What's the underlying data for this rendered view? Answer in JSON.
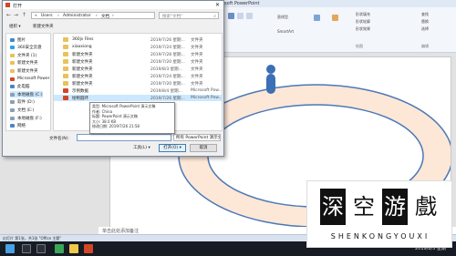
{
  "ppt": {
    "title": "osoft PowerPoint",
    "ribbon": {
      "grp1": [
        "直线型",
        "SmartArt"
      ],
      "grp2": [
        "形状填充",
        "形状轮廓",
        "形状效果"
      ],
      "grp3": [
        "查找",
        "替换",
        "选择"
      ],
      "grp_titles": [
        "绘图",
        "编辑"
      ]
    },
    "notes_placeholder": "单击此处添加备注",
    "status_text": "幻灯片 第1张，共1张    \"Office 主题\"",
    "zoom": "63%"
  },
  "dialog": {
    "title": "打开",
    "close": "✕",
    "breadcrumb": [
      "«",
      "Users",
      "›",
      "Administrator",
      "›",
      "文档",
      "›"
    ],
    "search_placeholder": "搜索\"文档\"",
    "toolbar": {
      "organize": "组织 ▾",
      "new_folder": "新建文件夹"
    },
    "nav_items": [
      {
        "label": "图片",
        "color": "#3f88d0"
      },
      {
        "label": "360安全云盘",
        "color": "#2aa3e8"
      },
      {
        "label": "文件夹 (1)",
        "color": "#e8c25a"
      },
      {
        "label": "新建文件夹",
        "color": "#e8c25a"
      },
      {
        "label": "新建文件夹",
        "color": "#e8c25a"
      },
      {
        "label": "Microsoft Power",
        "color": "#d24726"
      },
      {
        "label": "此电脑",
        "color": "#4a86c8"
      },
      {
        "label": "本地磁盘 (C:)",
        "color": "#8aa0b6"
      },
      {
        "label": "软件 (D:)",
        "color": "#8aa0b6"
      },
      {
        "label": "文档 (E:)",
        "color": "#8aa0b6"
      },
      {
        "label": "本地磁盘 (F:)",
        "color": "#8aa0b6"
      },
      {
        "label": "网络",
        "color": "#4a86c8"
      }
    ],
    "files": [
      {
        "name": "360js Files",
        "date": "2019/7/26 星期...",
        "type": "文件夹",
        "color": "#e8c25a"
      },
      {
        "name": "xiaoxiong",
        "date": "2019/7/24 星期...",
        "type": "文件夹",
        "color": "#e8c25a"
      },
      {
        "name": "新建文件夹",
        "date": "2019/7/28 星期...",
        "type": "文件夹",
        "color": "#e8c25a"
      },
      {
        "name": "新建文件夹",
        "date": "2019/7/20 星期...",
        "type": "文件夹",
        "color": "#e8c25a"
      },
      {
        "name": "新建文件夹",
        "date": "2019/8/3 星期...",
        "type": "文件夹",
        "color": "#e8c25a"
      },
      {
        "name": "新建文件夹",
        "date": "2019/7/24 星期...",
        "type": "文件夹",
        "color": "#e8c25a"
      },
      {
        "name": "新建文件夹",
        "date": "2019/7/20 星期...",
        "type": "文件夹",
        "color": "#e8c25a"
      },
      {
        "name": "示例数据",
        "date": "2019/8/4 星期...",
        "type": "Microsoft Pow...",
        "color": "#d24726"
      },
      {
        "name": "绘制圆环",
        "date": "2019/7/26 星期...",
        "type": "Microsoft Pow...",
        "color": "#d24726"
      }
    ],
    "tooltip": [
      "类型: Microsoft PowerPoint 演示文稿",
      "作者: China",
      "标题: PowerPoint 演示文稿",
      "大小: 38.0 KB",
      "修改日期: 2019/7/26 21:58"
    ],
    "filename_label": "文件名(N):",
    "filename_value": "",
    "filter": "所有 PowerPoint 演示文稿",
    "tools": "工具(L) ▾",
    "open": "打开(O) ▾",
    "cancel": "取消"
  },
  "taskbar": {
    "time": "2019/8/5 星期一"
  },
  "watermark": {
    "chars": [
      "深",
      "空",
      "游",
      "戲"
    ],
    "sub": "SHENKONGYOUXI"
  },
  "colors": {
    "ring_fill": "#fde7d6",
    "ring_stroke": "#4a78b8",
    "figure": "#3b6fb6"
  }
}
